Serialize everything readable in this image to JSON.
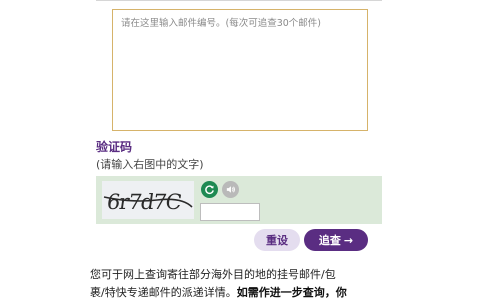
{
  "tracking": {
    "placeholder": "请在这里输入邮件编号。(每次可追查30个邮件)",
    "value": ""
  },
  "captcha": {
    "title": "验证码",
    "hint": "(请输入右图中的文字)",
    "image_text": "6r7d7C",
    "refresh_icon": "refresh-icon",
    "audio_icon": "speaker-icon",
    "input_value": ""
  },
  "buttons": {
    "reset_label": "重设",
    "track_label": "追查",
    "track_arrow": "→"
  },
  "info": {
    "line1": "您可于网上查询寄往部分海外目的地的挂号邮件/包",
    "line2_normal": "裹/特快专递邮件的派递详情。",
    "line2_bold": "如需作进一步查询，你"
  },
  "colors": {
    "brand_purple": "#5a2d82",
    "panel_green": "#dbe9d9",
    "textarea_border": "#d6b36a",
    "refresh_green": "#1f8a53"
  }
}
